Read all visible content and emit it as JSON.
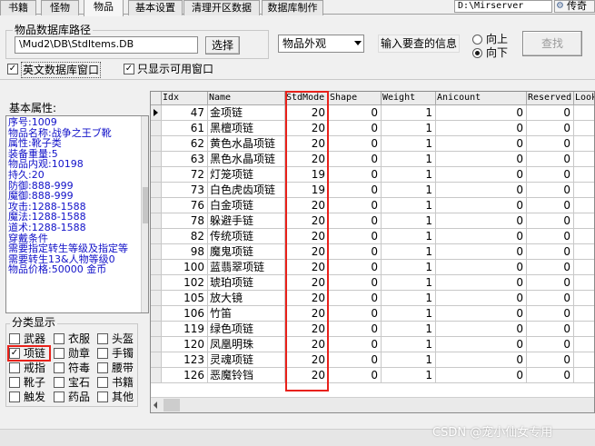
{
  "tabs": [
    "书籍",
    "怪物",
    "物品",
    "基本设置",
    "清理开区数据",
    "数据库制作"
  ],
  "active_tab": 2,
  "server_path": "D:\\Mirserver",
  "legend_button": "传奇",
  "db_group": {
    "title": "物品数据库路径",
    "path": "\\Mud2\\DB\\StdItems.DB",
    "select_label": "选择"
  },
  "search": {
    "combo_value": "物品外观",
    "input_placeholder": "输入要查的信息",
    "radio_up": "向上",
    "radio_down": "向下",
    "find_label": "查找"
  },
  "options": {
    "english_db": "英文数据库窗口",
    "only_available": "只显示可用窗口"
  },
  "attributes": {
    "title": "基本属性:",
    "lines": [
      "序号:1009",
      "物品名称:战争之王ブ靴",
      "属性:靴子类",
      "装备重量:5",
      "物品内观:10198",
      "持久:20",
      "防御:888-999",
      "魔御:888-999",
      "攻击:1288-1588",
      "魔法:1288-1588",
      "道术:1288-1588",
      "穿戴条件",
      "需要指定转生等级及指定等",
      "需要转生13&人物等级0",
      "物品价格:50000 金币"
    ]
  },
  "categories": {
    "title": "分类显示",
    "items": [
      {
        "label": "武器",
        "checked": false
      },
      {
        "label": "衣服",
        "checked": false
      },
      {
        "label": "头盔",
        "checked": false
      },
      {
        "label": "项链",
        "checked": true
      },
      {
        "label": "勋章",
        "checked": false
      },
      {
        "label": "手镯",
        "checked": false
      },
      {
        "label": "戒指",
        "checked": false
      },
      {
        "label": "符毒",
        "checked": false
      },
      {
        "label": "腰带",
        "checked": false
      },
      {
        "label": "靴子",
        "checked": false
      },
      {
        "label": "宝石",
        "checked": false
      },
      {
        "label": "书籍",
        "checked": false
      },
      {
        "label": "触发",
        "checked": false
      },
      {
        "label": "药品",
        "checked": false
      },
      {
        "label": "其他",
        "checked": false
      }
    ]
  },
  "grid": {
    "columns": [
      "Idx",
      "Name",
      "StdMode",
      "Shape",
      "Weight",
      "Anicount",
      "Reserved",
      "Looks"
    ],
    "rows": [
      [
        "47",
        "金项链",
        "20",
        "0",
        "1",
        "0",
        "0"
      ],
      [
        "61",
        "黑檀项链",
        "20",
        "0",
        "1",
        "0",
        "0"
      ],
      [
        "62",
        "黄色水晶项链",
        "20",
        "0",
        "1",
        "0",
        "0"
      ],
      [
        "63",
        "黑色水晶项链",
        "20",
        "0",
        "1",
        "0",
        "0"
      ],
      [
        "72",
        "灯笼项链",
        "19",
        "0",
        "1",
        "0",
        "0"
      ],
      [
        "73",
        "白色虎齿项链",
        "19",
        "0",
        "1",
        "0",
        "0"
      ],
      [
        "76",
        "白金项链",
        "20",
        "0",
        "1",
        "0",
        "0"
      ],
      [
        "78",
        "躲避手链",
        "20",
        "0",
        "1",
        "0",
        "0"
      ],
      [
        "82",
        "传统项链",
        "20",
        "0",
        "1",
        "0",
        "0"
      ],
      [
        "98",
        "魔鬼项链",
        "20",
        "0",
        "1",
        "0",
        "0"
      ],
      [
        "100",
        "蓝翡翠项链",
        "20",
        "0",
        "1",
        "0",
        "0"
      ],
      [
        "102",
        "琥珀项链",
        "20",
        "0",
        "1",
        "0",
        "0"
      ],
      [
        "105",
        "放大镜",
        "20",
        "0",
        "1",
        "0",
        "0"
      ],
      [
        "106",
        "竹笛",
        "20",
        "0",
        "1",
        "0",
        "0"
      ],
      [
        "119",
        "绿色项链",
        "20",
        "0",
        "1",
        "0",
        "0"
      ],
      [
        "120",
        "凤凰明珠",
        "20",
        "0",
        "1",
        "0",
        "0"
      ],
      [
        "123",
        "灵魂项链",
        "20",
        "0",
        "1",
        "0",
        "0"
      ],
      [
        "126",
        "恶魔铃铛",
        "20",
        "0",
        "1",
        "0",
        "0"
      ]
    ]
  },
  "watermark": "CSDN @宠小仙女专用",
  "colors": {
    "highlight": "#e8211a",
    "attr_text": "#1010c8"
  }
}
